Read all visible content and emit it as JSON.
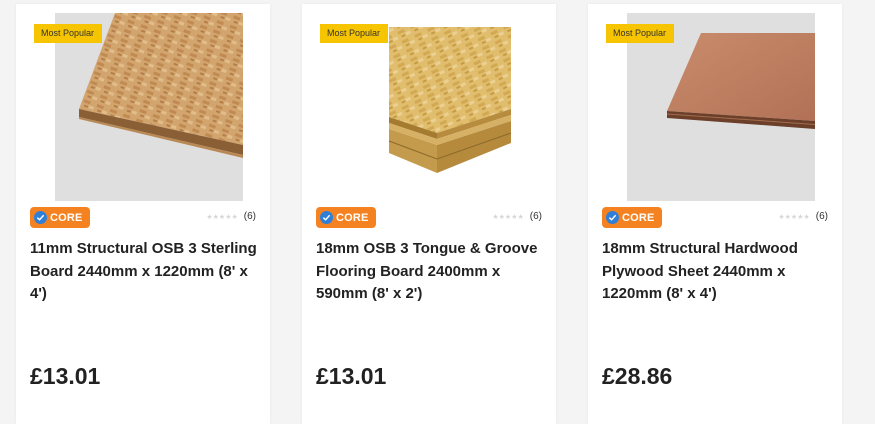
{
  "products": [
    {
      "badge": "Most Popular",
      "brand_tag": "CORE",
      "rating_stars": "★★★★★",
      "rating_count": "(6)",
      "title": "11mm Structural OSB 3 Sterling Board 2440mm x 1220mm (8' x 4')",
      "price": "£13.01",
      "image_icon": "osb-board-image"
    },
    {
      "badge": "Most Popular",
      "brand_tag": "CORE",
      "rating_stars": "★★★★★",
      "rating_count": "(6)",
      "title": "18mm OSB 3 Tongue & Groove Flooring Board 2400mm x 590mm (8' x 2')",
      "price": "£13.01",
      "image_icon": "tongue-groove-board-image"
    },
    {
      "badge": "Most Popular",
      "brand_tag": "CORE",
      "rating_stars": "★★★★★",
      "rating_count": "(6)",
      "title": "18mm Structural Hardwood Plywood Sheet 2440mm x 1220mm (8' x 4')",
      "price": "£28.86",
      "image_icon": "plywood-sheet-image"
    }
  ],
  "colors": {
    "badge_bg": "#f7c400",
    "core_bg": "#f58220",
    "check_bg": "#2f7fd8"
  }
}
